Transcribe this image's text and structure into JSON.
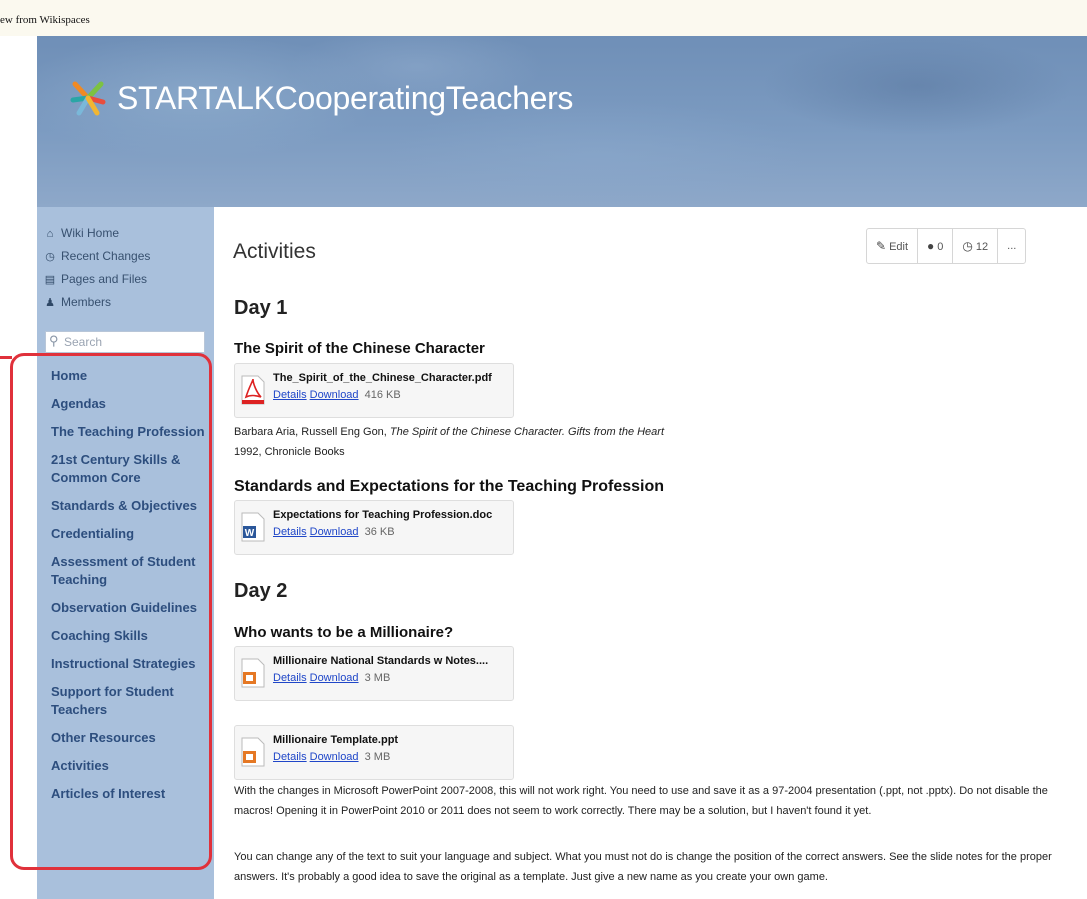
{
  "window": {
    "title_fragment": "ew from Wikispaces"
  },
  "site": {
    "title": "STARTALKCooperatingTeachers"
  },
  "sidebar": {
    "tools": [
      {
        "label": "Wiki Home",
        "icon": "home-icon"
      },
      {
        "label": "Recent Changes",
        "icon": "clock-icon"
      },
      {
        "label": "Pages and Files",
        "icon": "file-icon"
      },
      {
        "label": "Members",
        "icon": "user-icon"
      }
    ],
    "search_placeholder": "Search",
    "nav": [
      "Home",
      "Agendas",
      "The Teaching Profession",
      "21st Century Skills & Common Core",
      "Standards & Objectives",
      "Credentialing",
      "Assessment of Student Teaching",
      "Observation Guidelines",
      "Coaching Skills",
      "Instructional Strategies",
      "Support for Student Teachers",
      "Other Resources",
      "Activities",
      "Articles of Interest"
    ],
    "highlight_color": "#e0313b"
  },
  "page": {
    "title": "Activities",
    "actions": {
      "edit": "Edit",
      "comments": "0",
      "history": "12",
      "more": "..."
    },
    "day1": "Day 1",
    "day2": "Day 2",
    "s1": "The Spirit of the Chinese Character",
    "s2": "Standards and Expectations for the Teaching Profession",
    "s3": "Who wants to be a Millionaire?",
    "files": [
      {
        "name": "The_Spirit_of_the_Chinese_Character.pdf",
        "details": "Details",
        "download": "Download",
        "size": "416 KB",
        "type": "pdf"
      },
      {
        "name": "Expectations for Teaching Profession.doc",
        "details": "Details",
        "download": "Download",
        "size": "36 KB",
        "type": "doc"
      },
      {
        "name": "Millionaire National Standards w Notes....",
        "details": "Details",
        "download": "Download",
        "size": "3 MB",
        "type": "ppt"
      },
      {
        "name": "Millionaire Template.ppt",
        "details": "Details",
        "download": "Download",
        "size": "3 MB",
        "type": "ppt"
      }
    ],
    "citation": {
      "authors": "Barbara Aria, Russell Eng Gon, ",
      "work": "The Spirit of the Chinese Character. Gifts from the Heart",
      "publisher": "1992, Chronicle Books"
    },
    "para1": "With the changes in Microsoft PowerPoint 2007-2008, this will not work right. You need to use and save it as a 97-2004 presentation (.ppt, not .pptx). Do not disable the macros! Opening it in PowerPoint 2010 or 2011 does not seem to work correctly. There may be a solution, but I haven't found it yet.",
    "para2": "You can change any of the text to suit your language and subject. What you must not do is change the position of the correct answers. See the slide notes for the proper answers. It's probably a good idea to save the original as a template. Just give a new name as you create your own game."
  }
}
